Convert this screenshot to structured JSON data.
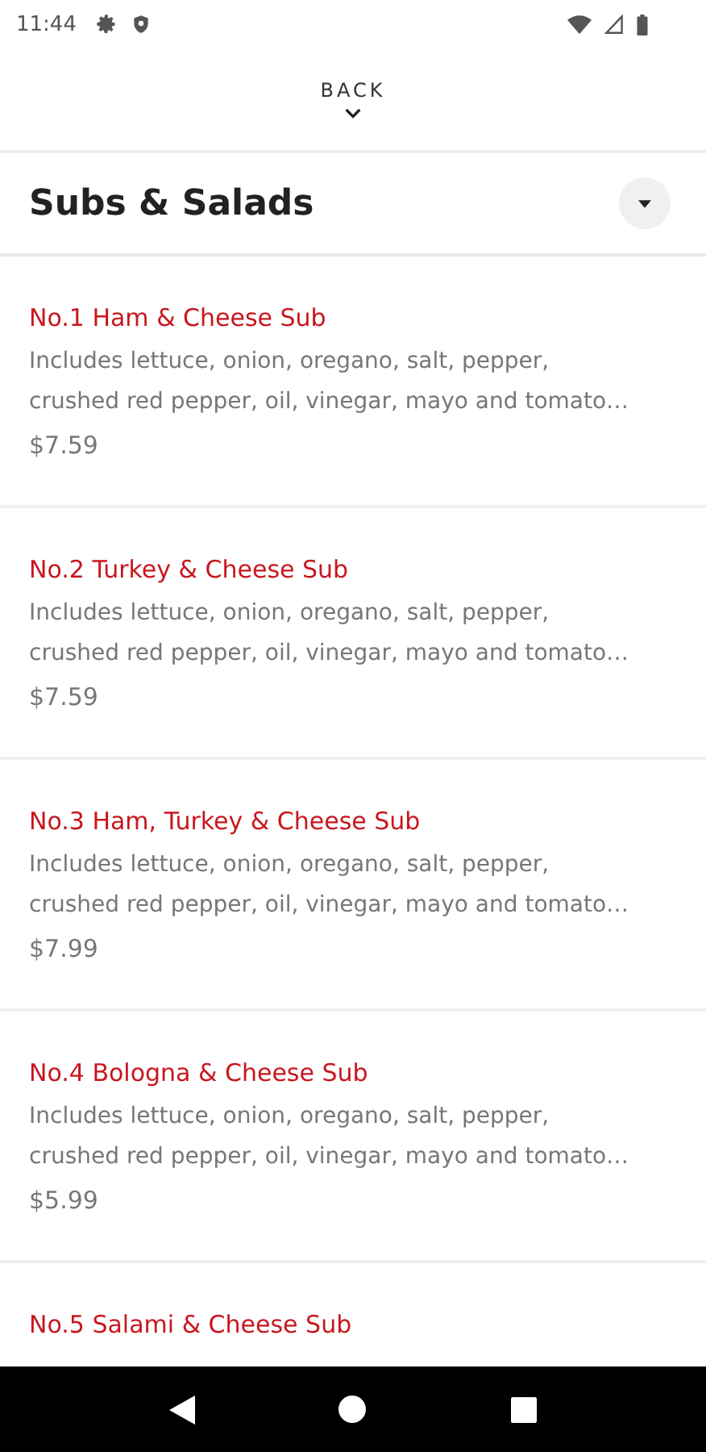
{
  "status_bar": {
    "time": "11:44"
  },
  "back": {
    "label": "BACK"
  },
  "section": {
    "title": "Subs & Salads",
    "expanded": true
  },
  "items": [
    {
      "name": "No.1 Ham & Cheese Sub",
      "description": "Includes lettuce, onion, oregano, salt, pepper,\ncrushed red pepper, oil, vinegar, mayo and tomato…",
      "price": "$7.59"
    },
    {
      "name": "No.2 Turkey & Cheese Sub",
      "description": "Includes lettuce, onion, oregano, salt, pepper,\ncrushed red pepper, oil, vinegar, mayo and tomato…",
      "price": "$7.59"
    },
    {
      "name": "No.3 Ham, Turkey & Cheese Sub",
      "description": "Includes lettuce, onion, oregano, salt, pepper,\ncrushed red pepper, oil, vinegar, mayo and tomato…",
      "price": "$7.99"
    },
    {
      "name": "No.4 Bologna & Cheese Sub",
      "description": "Includes lettuce, onion, oregano, salt, pepper,\ncrushed red pepper, oil, vinegar, mayo and tomato…",
      "price": "$5.99"
    },
    {
      "name": "No.5 Salami & Cheese Sub"
    }
  ]
}
